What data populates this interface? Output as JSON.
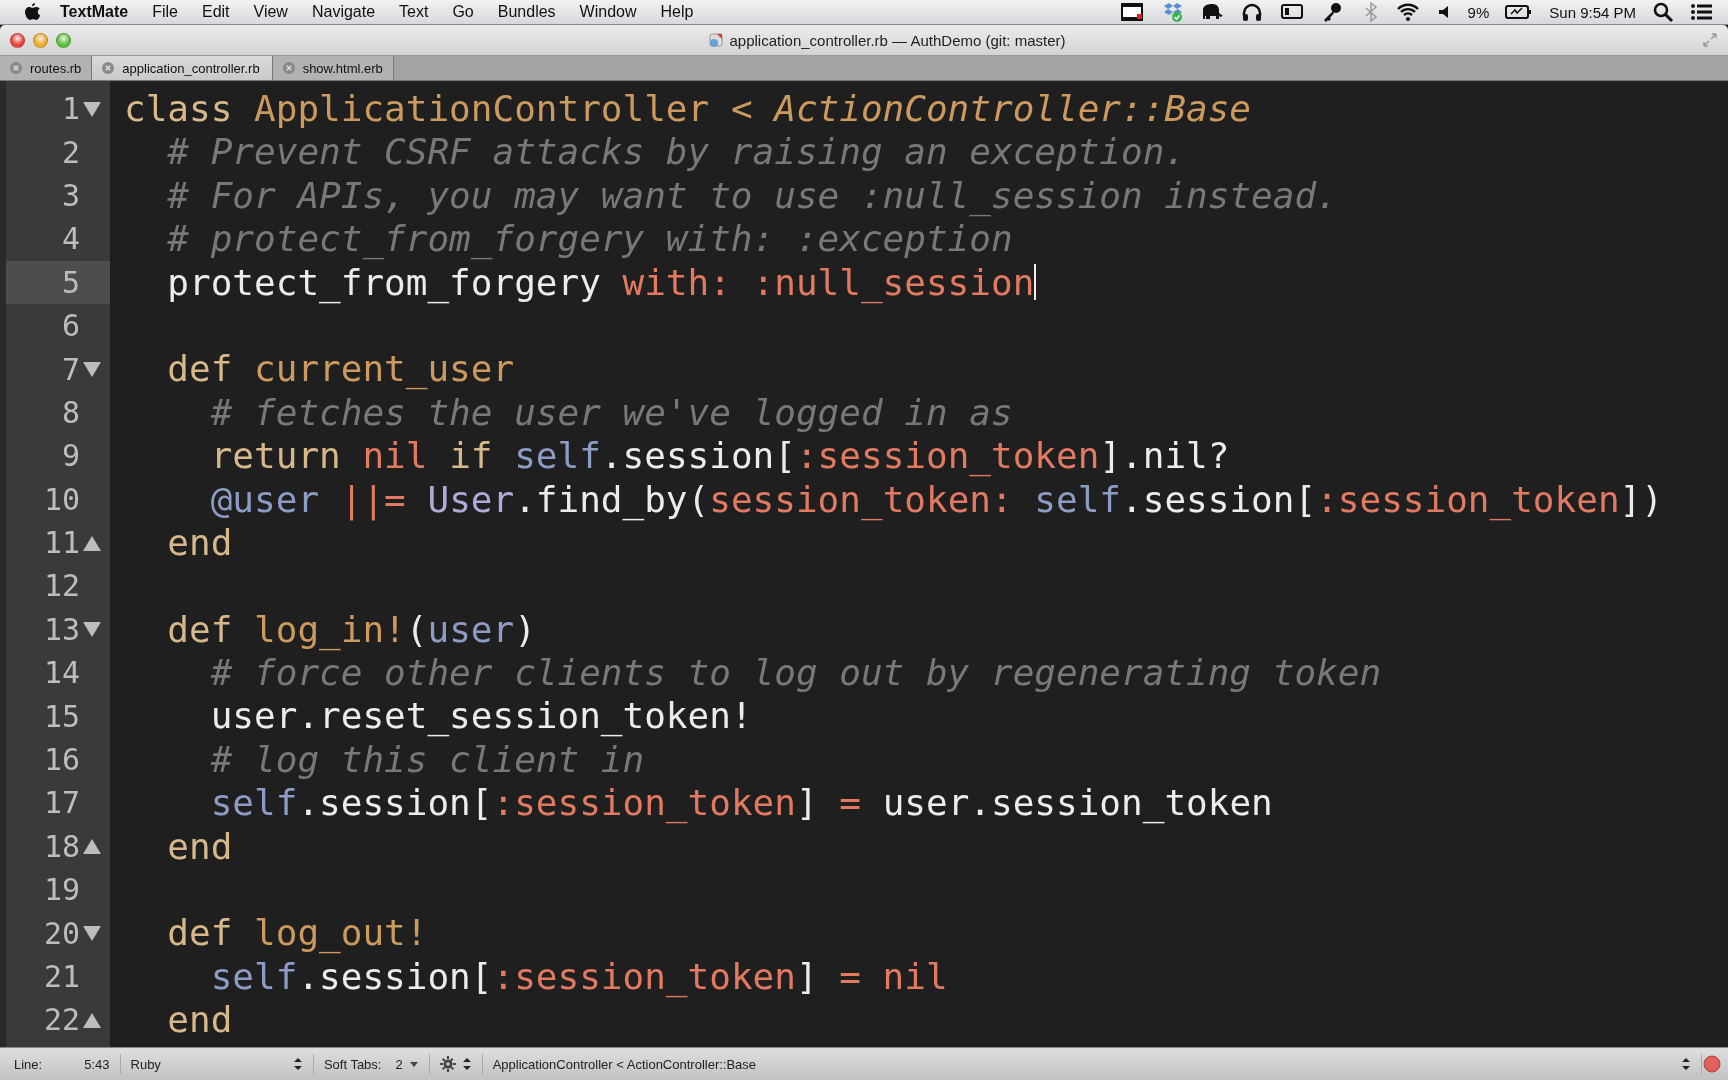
{
  "menu_bar": {
    "app_name": "TextMate",
    "items": [
      "File",
      "Edit",
      "View",
      "Navigate",
      "Text",
      "Go",
      "Bundles",
      "Window",
      "Help"
    ],
    "battery": "9%",
    "clock": "Sun 9:54 PM"
  },
  "window": {
    "title": "application_controller.rb — AuthDemo (git: master)"
  },
  "tabs": [
    {
      "label": "routes.rb",
      "selected": false
    },
    {
      "label": "application_controller.rb",
      "selected": true
    },
    {
      "label": "show.html.erb",
      "selected": false
    }
  ],
  "lines": [
    {
      "number": "1",
      "fold_start": true,
      "fold_end": false,
      "current": false,
      "tokens": [
        {
          "kind": "keyword",
          "text": "class "
        },
        {
          "kind": "entity",
          "text": "ApplicationController "
        },
        {
          "kind": "inherited",
          "text": "< ActionController::Base"
        }
      ]
    },
    {
      "number": "2",
      "fold_start": false,
      "fold_end": false,
      "current": false,
      "tokens": [
        {
          "kind": "comment",
          "text": "  # Prevent CSRF attacks by raising an exception."
        }
      ]
    },
    {
      "number": "3",
      "fold_start": false,
      "fold_end": false,
      "current": false,
      "tokens": [
        {
          "kind": "comment",
          "text": "  # For APIs, you may want to use :null_session instead."
        }
      ]
    },
    {
      "number": "4",
      "fold_start": false,
      "fold_end": false,
      "current": false,
      "tokens": [
        {
          "kind": "comment",
          "text": "  # protect_from_forgery with: :exception"
        }
      ]
    },
    {
      "number": "5",
      "fold_start": false,
      "fold_end": false,
      "current": true,
      "tokens": [
        {
          "kind": "plain",
          "text": "  protect_from_forgery "
        },
        {
          "kind": "symbol",
          "text": "with: :null_session"
        }
      ]
    },
    {
      "number": "6",
      "fold_start": false,
      "fold_end": false,
      "current": false
    },
    {
      "number": "7",
      "fold_start": true,
      "fold_end": false,
      "current": false,
      "tokens": [
        {
          "kind": "keyword",
          "text": "  def "
        },
        {
          "kind": "entity",
          "text": "current_user"
        }
      ]
    },
    {
      "number": "8",
      "fold_start": false,
      "fold_end": false,
      "current": false,
      "tokens": [
        {
          "kind": "comment",
          "text": "    # fetches the user we've logged in as"
        }
      ]
    },
    {
      "number": "9",
      "fold_start": false,
      "fold_end": false,
      "current": false,
      "tokens": [
        {
          "kind": "keyword",
          "text": "    return "
        },
        {
          "kind": "symbol",
          "text": "nil "
        },
        {
          "kind": "keyword",
          "text": "if "
        },
        {
          "kind": "variable",
          "text": "self"
        },
        {
          "kind": "plain",
          "text": ".session["
        },
        {
          "kind": "symbol",
          "text": ":session_token"
        },
        {
          "kind": "plain",
          "text": "].nil?"
        }
      ]
    },
    {
      "number": "10",
      "fold_start": false,
      "fold_end": false,
      "current": false,
      "tokens": [
        {
          "kind": "variable",
          "text": "    @user"
        },
        {
          "kind": "symbol",
          "text": " ||= "
        },
        {
          "kind": "constant",
          "text": "User"
        },
        {
          "kind": "plain",
          "text": ".find_by("
        },
        {
          "kind": "symbol",
          "text": "session_token: "
        },
        {
          "kind": "variable",
          "text": "self"
        },
        {
          "kind": "plain",
          "text": ".session["
        },
        {
          "kind": "symbol",
          "text": ":session_token"
        },
        {
          "kind": "plain",
          "text": "])"
        }
      ]
    },
    {
      "number": "11",
      "fold_start": false,
      "fold_end": true,
      "current": false,
      "tokens": [
        {
          "kind": "keyword",
          "text": "  end"
        }
      ]
    },
    {
      "number": "12",
      "fold_start": false,
      "fold_end": false,
      "current": false
    },
    {
      "number": "13",
      "fold_start": true,
      "fold_end": false,
      "current": false,
      "tokens": [
        {
          "kind": "keyword",
          "text": "  def "
        },
        {
          "kind": "entity",
          "text": "log_in!"
        },
        {
          "kind": "plain",
          "text": "("
        },
        {
          "kind": "variable",
          "text": "user"
        },
        {
          "kind": "plain",
          "text": ")"
        }
      ]
    },
    {
      "number": "14",
      "fold_start": false,
      "fold_end": false,
      "current": false,
      "tokens": [
        {
          "kind": "comment",
          "text": "    # force other clients to log out by regenerating token"
        }
      ]
    },
    {
      "number": "15",
      "fold_start": false,
      "fold_end": false,
      "current": false,
      "tokens": [
        {
          "kind": "plain",
          "text": "    user.reset_session_token!"
        }
      ]
    },
    {
      "number": "16",
      "fold_start": false,
      "fold_end": false,
      "current": false,
      "tokens": [
        {
          "kind": "comment",
          "text": "    # log this client in"
        }
      ]
    },
    {
      "number": "17",
      "fold_start": false,
      "fold_end": false,
      "current": false,
      "tokens": [
        {
          "kind": "variable",
          "text": "    self"
        },
        {
          "kind": "plain",
          "text": ".session["
        },
        {
          "kind": "symbol",
          "text": ":session_token"
        },
        {
          "kind": "plain",
          "text": "] "
        },
        {
          "kind": "symbol",
          "text": "="
        },
        {
          "kind": "plain",
          "text": " user.session_token"
        }
      ]
    },
    {
      "number": "18",
      "fold_start": false,
      "fold_end": true,
      "current": false,
      "tokens": [
        {
          "kind": "keyword",
          "text": "  end"
        }
      ]
    },
    {
      "number": "19",
      "fold_start": false,
      "fold_end": false,
      "current": false
    },
    {
      "number": "20",
      "fold_start": true,
      "fold_end": false,
      "current": false,
      "tokens": [
        {
          "kind": "keyword",
          "text": "  def "
        },
        {
          "kind": "entity",
          "text": "log_out!"
        }
      ]
    },
    {
      "number": "21",
      "fold_start": false,
      "fold_end": false,
      "current": false,
      "tokens": [
        {
          "kind": "variable",
          "text": "    self"
        },
        {
          "kind": "plain",
          "text": ".session["
        },
        {
          "kind": "symbol",
          "text": ":session_token"
        },
        {
          "kind": "plain",
          "text": "] "
        },
        {
          "kind": "symbol",
          "text": "= nil"
        }
      ]
    },
    {
      "number": "22",
      "fold_start": false,
      "fold_end": true,
      "current": false,
      "tokens": [
        {
          "kind": "keyword",
          "text": "  end"
        }
      ]
    }
  ],
  "status_bar": {
    "line_label": "Line:",
    "position": "5:43",
    "language": "Ruby",
    "tabs_label": "Soft Tabs:",
    "tab_size": "2",
    "symbol": "ApplicationController < ActionController::Base"
  }
}
